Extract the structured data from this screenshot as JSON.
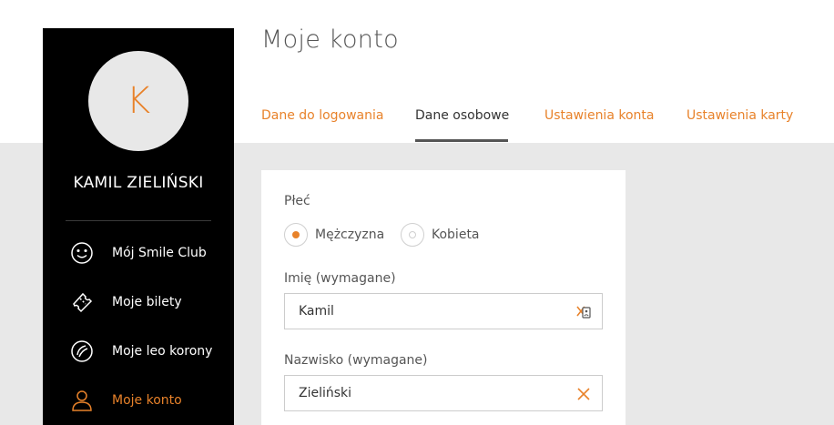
{
  "page": {
    "title": "Moje konto"
  },
  "colors": {
    "accent": "#e8822a",
    "sidebar_bg": "#000000",
    "content_bg": "#e8e8e8"
  },
  "sidebar": {
    "avatar_initial": "K",
    "user_name": "KAMIL ZIELIŃSKI",
    "items": [
      {
        "label": "Mój Smile Club",
        "icon": "smile-icon",
        "active": false
      },
      {
        "label": "Moje bilety",
        "icon": "ticket-icon",
        "active": false
      },
      {
        "label": "Moje leo korony",
        "icon": "crown-coin-icon",
        "active": false
      },
      {
        "label": "Moje konto",
        "icon": "user-icon",
        "active": true
      }
    ]
  },
  "tabs": [
    {
      "label": "Dane do logowania",
      "active": false
    },
    {
      "label": "Dane osobowe",
      "active": true
    },
    {
      "label": "Ustawienia konta",
      "active": false
    },
    {
      "label": "Ustawienia karty",
      "active": false
    }
  ],
  "form": {
    "gender_label": "Płeć",
    "gender_options": [
      {
        "label": "Mężczyzna",
        "selected": true
      },
      {
        "label": "Kobieta",
        "selected": false
      }
    ],
    "first_name_label": "Imię (wymagane)",
    "first_name_value": "Kamil",
    "last_name_label": "Nazwisko (wymagane)",
    "last_name_value": "Zieliński"
  }
}
